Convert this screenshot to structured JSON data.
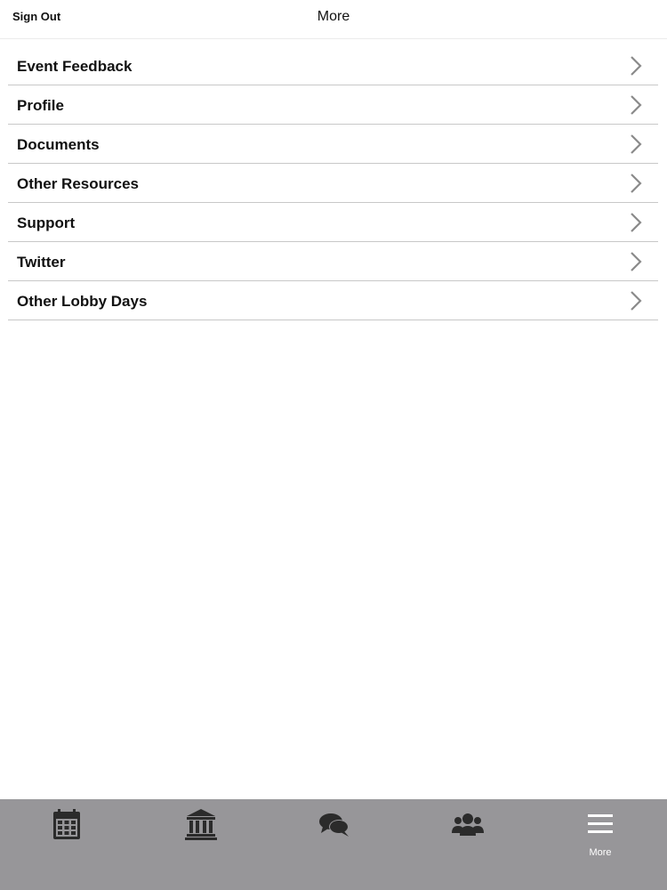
{
  "header": {
    "sign_out": "Sign Out",
    "title": "More"
  },
  "menu": {
    "items": [
      {
        "label": "Event Feedback"
      },
      {
        "label": "Profile"
      },
      {
        "label": "Documents"
      },
      {
        "label": "Other Resources"
      },
      {
        "label": "Support"
      },
      {
        "label": "Twitter"
      },
      {
        "label": "Other Lobby Days"
      }
    ],
    "chevron_icon": "chevron-right-icon"
  },
  "tabbar": {
    "background": "#979699",
    "icon_color_inactive": "#2b2b2b",
    "icon_color_active": "#ffffff",
    "tabs": [
      {
        "icon": "calendar-icon"
      },
      {
        "icon": "capitol-building-icon"
      },
      {
        "icon": "chat-bubbles-icon"
      },
      {
        "icon": "group-icon"
      },
      {
        "icon": "hamburger-menu-icon",
        "label": "More",
        "active": true
      }
    ]
  }
}
